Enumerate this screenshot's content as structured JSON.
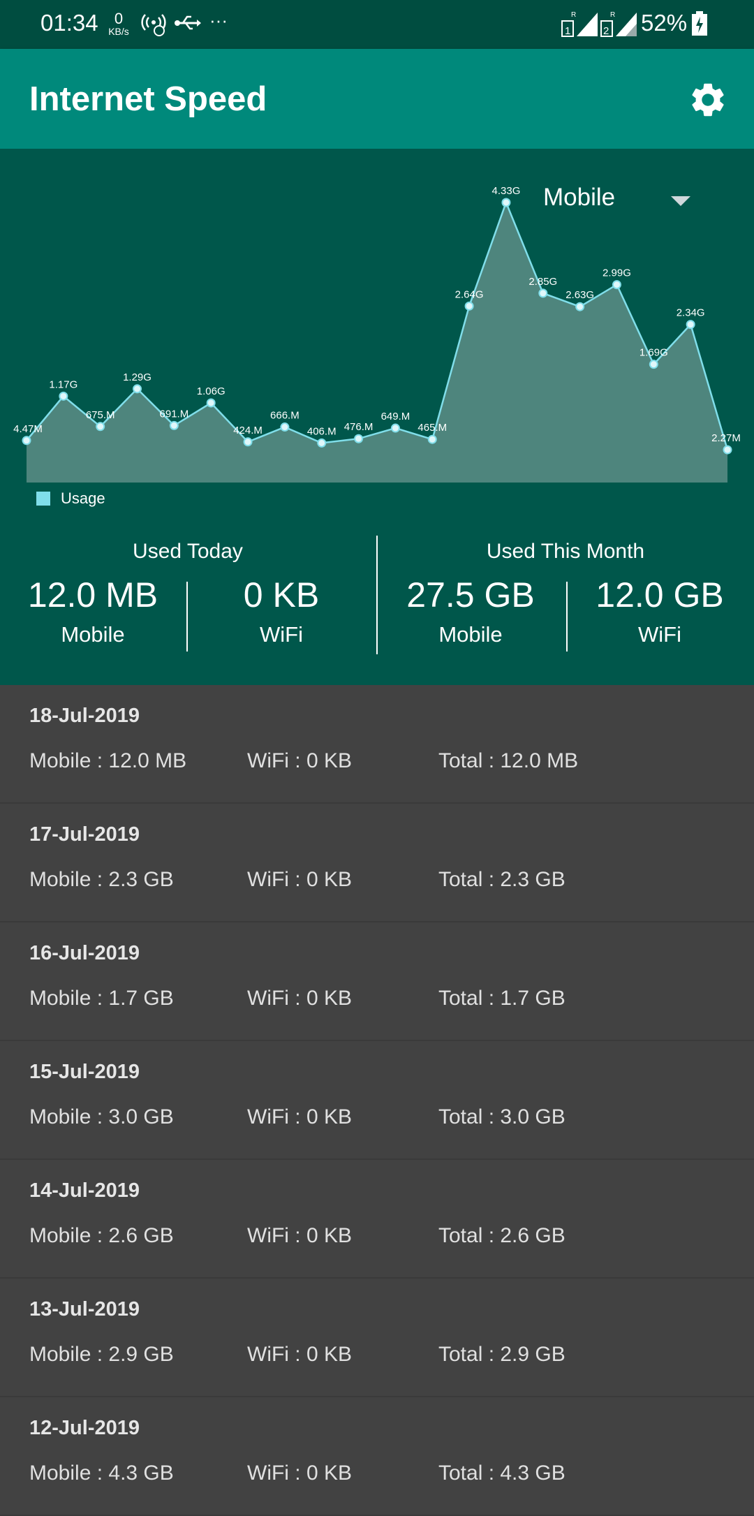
{
  "status_bar": {
    "time": "01:34",
    "net_speed_value": "0",
    "net_speed_unit": "KB/s",
    "more": "···",
    "battery": "52%",
    "icons": [
      "hotspot-icon",
      "usb-icon",
      "sim1-signal-icon",
      "sim2-signal-icon",
      "battery-charging-icon"
    ]
  },
  "app_bar": {
    "title": "Internet Speed",
    "settings_icon": "gear-icon"
  },
  "network_selector": {
    "selected": "Mobile"
  },
  "chart_data": {
    "type": "area",
    "legend": [
      "Usage"
    ],
    "series": [
      {
        "name": "Usage",
        "values": [
          0.447,
          1.17,
          0.675,
          1.29,
          0.691,
          1.06,
          0.424,
          0.666,
          0.406,
          0.476,
          0.649,
          0.465,
          2.64,
          4.33,
          2.85,
          2.63,
          2.99,
          1.69,
          2.34,
          0.227
        ],
        "labels": [
          "4.47M",
          "1.17G",
          "675.M",
          "1.29G",
          "691.M",
          "1.06G",
          "424.M",
          "666.M",
          "406.M",
          "476.M",
          "649.M",
          "465.M",
          "2.64G",
          "4.33G",
          "2.85G",
          "2.63G",
          "2.99G",
          "1.69G",
          "2.34G",
          "2.27M"
        ]
      }
    ],
    "colors": {
      "line": "#80DEEA",
      "fill": "#4E857D"
    }
  },
  "summary": {
    "today": {
      "heading": "Used Today",
      "mobile_value": "12.0 MB",
      "mobile_label": "Mobile",
      "wifi_value": "0 KB",
      "wifi_label": "WiFi"
    },
    "month": {
      "heading": "Used This Month",
      "mobile_value": "27.5 GB",
      "mobile_label": "Mobile",
      "wifi_value": "12.0 GB",
      "wifi_label": "WiFi"
    }
  },
  "history": [
    {
      "date": "18-Jul-2019",
      "mobile": "Mobile : 12.0 MB",
      "wifi": "WiFi : 0 KB",
      "total": "Total : 12.0 MB"
    },
    {
      "date": "17-Jul-2019",
      "mobile": "Mobile : 2.3 GB",
      "wifi": "WiFi : 0 KB",
      "total": "Total : 2.3 GB"
    },
    {
      "date": "16-Jul-2019",
      "mobile": "Mobile : 1.7 GB",
      "wifi": "WiFi : 0 KB",
      "total": "Total : 1.7 GB"
    },
    {
      "date": "15-Jul-2019",
      "mobile": "Mobile : 3.0 GB",
      "wifi": "WiFi : 0 KB",
      "total": "Total : 3.0 GB"
    },
    {
      "date": "14-Jul-2019",
      "mobile": "Mobile : 2.6 GB",
      "wifi": "WiFi : 0 KB",
      "total": "Total : 2.6 GB"
    },
    {
      "date": "13-Jul-2019",
      "mobile": "Mobile : 2.9 GB",
      "wifi": "WiFi : 0 KB",
      "total": "Total : 2.9 GB"
    },
    {
      "date": "12-Jul-2019",
      "mobile": "Mobile : 4.3 GB",
      "wifi": "WiFi : 0 KB",
      "total": "Total : 4.3 GB"
    }
  ],
  "colors": {
    "status_bar": "#004D40",
    "app_bar": "#00897B",
    "chart_panel": "#00574B",
    "list_bg": "#424242"
  }
}
